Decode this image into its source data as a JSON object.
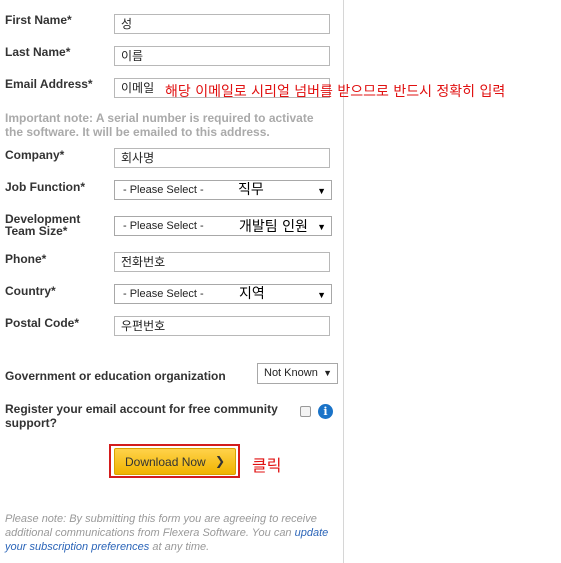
{
  "form": {
    "first_name": {
      "label": "First Name*",
      "value": "성"
    },
    "last_name": {
      "label": "Last Name*",
      "value": "이름"
    },
    "email": {
      "label": "Email Address*",
      "value": "이메일",
      "annotation": "해당 이메일로 시리얼 넘버를 받으므로 반드시 정확히 입력"
    },
    "important_note": "Important note: A serial number is required to activate the software. It will be emailed to this address.",
    "company": {
      "label": "Company*",
      "value": "회사명"
    },
    "job_function": {
      "label": "Job Function*",
      "selected": "- Please Select -",
      "annotation": "직무"
    },
    "team_size": {
      "label_line1": "Development",
      "label_line2": "Team Size*",
      "selected": "- Please Select -",
      "annotation": "개발팀 인원"
    },
    "phone": {
      "label": "Phone*",
      "value": "전화번호"
    },
    "country": {
      "label": "Country*",
      "selected": "- Please Select -",
      "annotation": "지역"
    },
    "postal_code": {
      "label": "Postal Code*",
      "value": "우편번호"
    },
    "gov_org": {
      "label": "Government or education organization",
      "selected": "Not Known"
    },
    "register": {
      "label": "Register your email account for free community support?",
      "checked": false
    },
    "download_button": "Download Now",
    "click_annotation": "클릭",
    "disclaimer_prefix": "Please note: By submitting this form you are agreeing to receive additional communications from Flexera Software. You can ",
    "disclaimer_link": "update your subscription preferences",
    "disclaimer_suffix": " at any time."
  },
  "colors": {
    "accent_red": "#e01010",
    "button_yellow": "#f5c21c",
    "link_blue": "#2a64b8",
    "info_blue": "#1a73c8"
  }
}
